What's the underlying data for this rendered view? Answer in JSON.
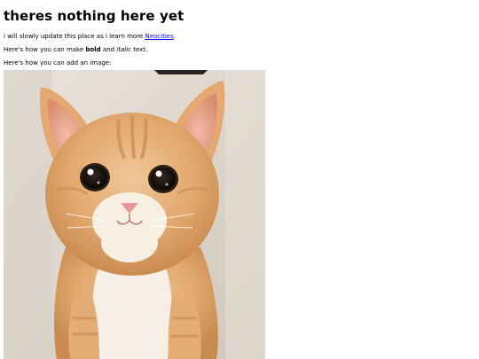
{
  "page": {
    "title": "theres nothing here yet",
    "intro": {
      "before_link": "i will slowly update this place as i learn more ",
      "link_text": "Neocities",
      "after_link": "."
    },
    "formatting_line": {
      "before_bold": "Here's how you can make ",
      "bold_text": "bold",
      "between": " and ",
      "italic_text": "italic",
      "after_italic": " text."
    },
    "image_line": "Here's how you can add an image:",
    "image": {
      "subject": "kitten"
    }
  },
  "colors": {
    "link": "#0000ee",
    "text": "#000000",
    "background": "#ffffff"
  }
}
